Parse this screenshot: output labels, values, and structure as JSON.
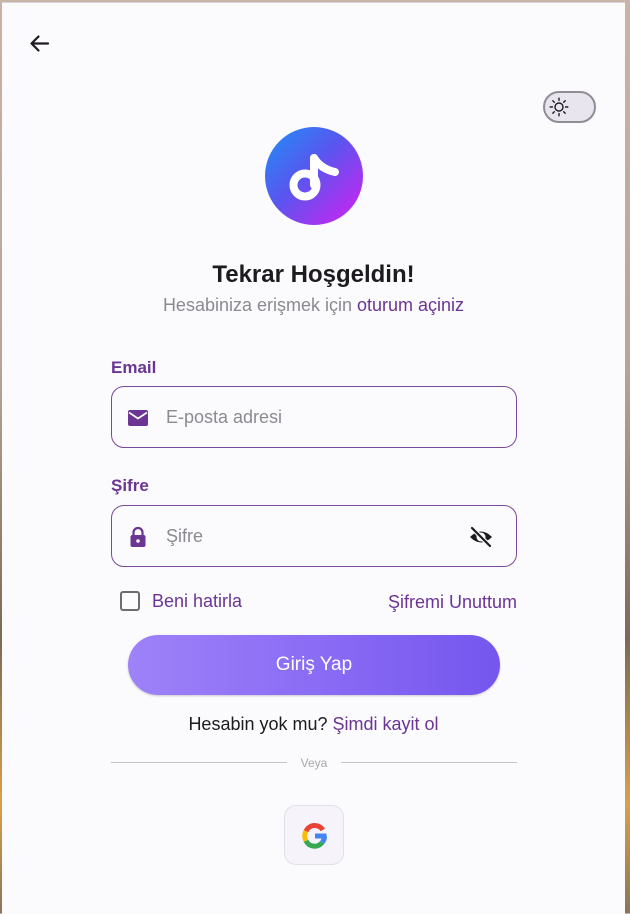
{
  "header": {
    "back_icon": "arrow-left-icon",
    "theme_icon": "sun-icon"
  },
  "brand": {
    "logo_icon": "music-note-icon",
    "gradient": [
      "#1e8ff7",
      "#d61ff0"
    ]
  },
  "welcome": {
    "title": "Tekrar Hoşgeldin!",
    "subtitle_plain": "Hesabiniza erişmek için ",
    "subtitle_accent": "oturum açiniz"
  },
  "form": {
    "email_label": "Email",
    "email_placeholder": "E-posta adresi",
    "email_icon": "mail-icon",
    "password_label": "Şifre",
    "password_placeholder": "Şifre",
    "password_icon": "lock-icon",
    "visibility_icon": "eye-off-icon",
    "remember_label": "Beni hatirla",
    "forgot_label": "Şifremi Unuttum",
    "login_label": "Giriş Yap"
  },
  "signup": {
    "prompt": "Hesabin yok mu? ",
    "link": "Şimdi kayit ol"
  },
  "divider": {
    "label": "Veya"
  },
  "social": {
    "google_icon": "google-icon"
  },
  "colors": {
    "accent": "#6a3593",
    "button_start": "#9e82f8",
    "button_end": "#7556ee"
  }
}
